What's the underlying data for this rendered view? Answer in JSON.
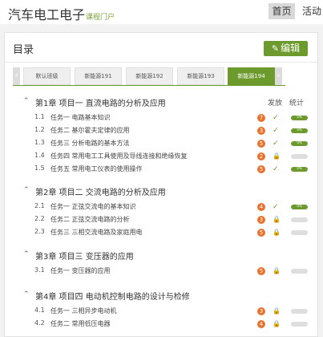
{
  "header": {
    "site_title": "汽车电工电子",
    "site_subtitle": "课程门户",
    "nav_home": "首页",
    "nav_activity": "活动"
  },
  "panel": {
    "title": "目录",
    "edit_label": "编辑",
    "edit_icon": "pencil-icon"
  },
  "tabs": [
    {
      "label": "默认班级",
      "active": false
    },
    {
      "label": "新能源191",
      "active": false
    },
    {
      "label": "新能源192",
      "active": false
    },
    {
      "label": "新能源193",
      "active": false
    },
    {
      "label": "新能源194",
      "active": true
    }
  ],
  "columns": {
    "release": "发放",
    "stats": "统计"
  },
  "chapters": [
    {
      "title": "第1章 项目一 直流电路的分析及应用",
      "items": [
        {
          "num": "1.1",
          "label": "任务一 电路基本知识",
          "count": "7",
          "status": "check",
          "progress": 1.0,
          "progress_text": "0%"
        },
        {
          "num": "1.2",
          "label": "任务二 基尔霍夫定律的应用",
          "count": "3",
          "status": "check",
          "progress": 1.0,
          "progress_text": "0%"
        },
        {
          "num": "1.3",
          "label": "任务三 分析电路的基本方法",
          "count": "5",
          "status": "check",
          "progress": 1.0,
          "progress_text": "0%"
        },
        {
          "num": "1.4",
          "label": "任务四 常用电工工具使用及导线连接和绝缘恢复",
          "count": "2",
          "status": "lock",
          "progress": 0,
          "progress_text": ""
        },
        {
          "num": "1.5",
          "label": "任务五 常用电工仪表的使用操作",
          "count": "5",
          "status": "check",
          "progress": 1.0,
          "progress_text": "0%"
        }
      ]
    },
    {
      "title": "第2章 项目二 交流电路的分析及应用",
      "items": [
        {
          "num": "2.1",
          "label": "任务一 正弦交流电的基本知识",
          "count": "4",
          "status": "check",
          "progress": 1.0,
          "progress_text": "0%"
        },
        {
          "num": "2.2",
          "label": "任务二 正弦交流电路的分析",
          "count": "3",
          "status": "lock",
          "progress": 0,
          "progress_text": ""
        },
        {
          "num": "2.3",
          "label": "任务三 三相交流电路及家庭用电",
          "count": "5",
          "status": "lock",
          "progress": 0,
          "progress_text": ""
        }
      ]
    },
    {
      "title": "第3章 项目三 变压器的应用",
      "items": [
        {
          "num": "3.1",
          "label": "任务一 变压器的应用",
          "count": "5",
          "status": "lock",
          "progress": 0,
          "progress_text": ""
        }
      ]
    },
    {
      "title": "第4章 项目四 电动机控制电路的设计与检修",
      "items": [
        {
          "num": "4.1",
          "label": "任务一 三相异步电动机",
          "count": "3",
          "status": "lock",
          "progress": 0,
          "progress_text": ""
        },
        {
          "num": "4.2",
          "label": "任务二 常用低压电器",
          "count": "4",
          "status": "lock",
          "progress": 0,
          "progress_text": ""
        }
      ]
    }
  ]
}
